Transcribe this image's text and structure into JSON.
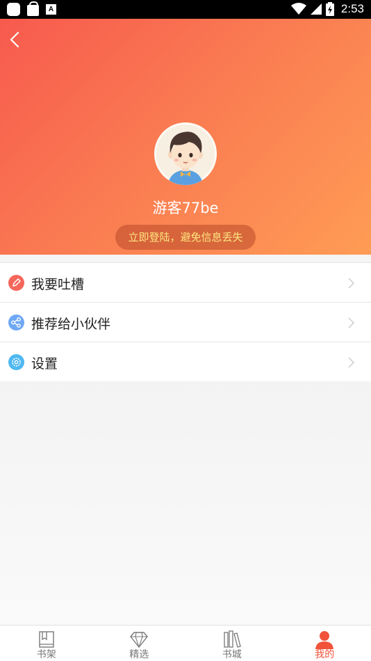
{
  "status_bar": {
    "time": "2:53",
    "icons": [
      "app-notification-icon",
      "shopping-bag-icon",
      "a-badge-icon",
      "wifi-icon",
      "signal-icon",
      "battery-icon"
    ]
  },
  "header": {
    "back_icon": "chevron-left-icon",
    "username": "游客77be",
    "login_tip": "立即登陆，避免信息丢失",
    "gradient_colors": [
      "#f75a4e",
      "#ff9c55"
    ]
  },
  "menu": {
    "items": [
      {
        "label": "我要吐槽",
        "icon": "pencil-icon",
        "icon_color": "#f5675b"
      },
      {
        "label": "推荐给小伙伴",
        "icon": "share-icon",
        "icon_color": "#6fa8f5"
      },
      {
        "label": "设置",
        "icon": "gear-icon",
        "icon_color": "#4fb8f0"
      }
    ]
  },
  "bottom_nav": {
    "items": [
      {
        "label": "书架",
        "icon": "bookshelf-icon",
        "active": false
      },
      {
        "label": "精选",
        "icon": "diamond-icon",
        "active": false
      },
      {
        "label": "书城",
        "icon": "books-icon",
        "active": false
      },
      {
        "label": "我的",
        "icon": "person-icon",
        "active": true
      }
    ],
    "active_color": "#f0533a"
  }
}
